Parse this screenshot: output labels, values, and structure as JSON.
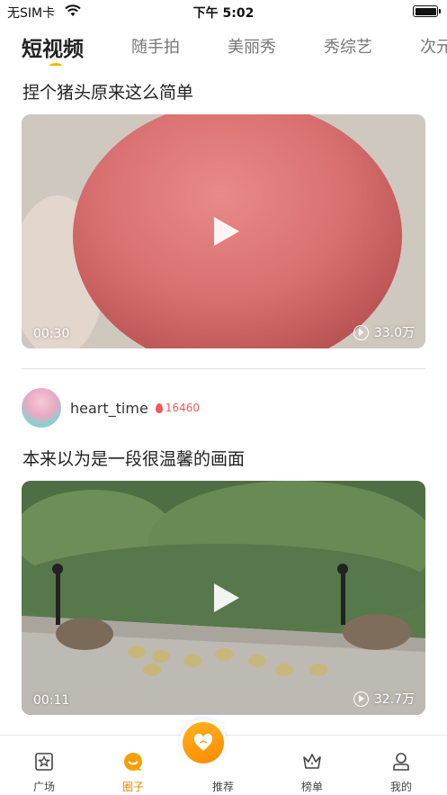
{
  "status_bar": {
    "carrier": "无SIM卡",
    "time": "下午 5:02"
  },
  "top_tabs": [
    {
      "label": "短视频",
      "active": true
    },
    {
      "label": "随手拍",
      "active": false
    },
    {
      "label": "美丽秀",
      "active": false
    },
    {
      "label": "秀综艺",
      "active": false
    },
    {
      "label": "次元",
      "active": false
    }
  ],
  "posts": [
    {
      "title": "捏个猪头原来这么简单",
      "duration": "00:30",
      "views": "33.0万"
    },
    {
      "author": "heart_time",
      "heat": "16460",
      "title": "本来以为是一段很温馨的画面",
      "duration": "00:11",
      "views": "32.7万"
    }
  ],
  "bottom_nav": [
    {
      "label": "广场",
      "icon": "square-star-icon",
      "active": false
    },
    {
      "label": "圈子",
      "icon": "circle-bubble-icon",
      "active": true
    },
    {
      "label": "推荐",
      "icon": "heart-icon",
      "active": false
    },
    {
      "label": "榜单",
      "icon": "crown-icon",
      "active": false
    },
    {
      "label": "我的",
      "icon": "user-icon",
      "active": false
    }
  ],
  "colors": {
    "accent": "#f6b500",
    "active_nav": "#f08a00",
    "heat": "#f05a5a"
  }
}
